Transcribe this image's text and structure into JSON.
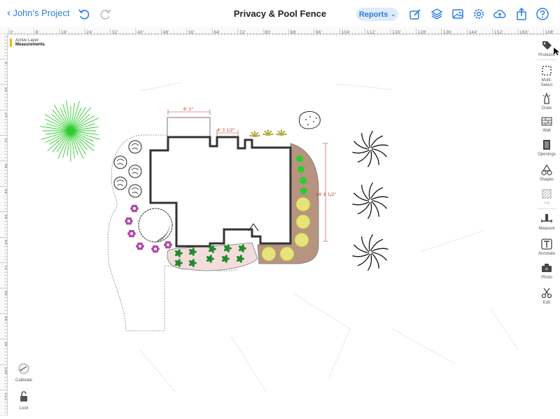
{
  "header": {
    "back_label": "John's Project",
    "title": "Privacy & Pool Fence",
    "reports_label": "Reports"
  },
  "ruler": {
    "top_ticks": [
      "0'",
      "8'",
      "16'",
      "24'",
      "32'",
      "40'",
      "48'",
      "56'",
      "64'",
      "72'",
      "80'",
      "88'",
      "96'",
      "104'",
      "112'",
      "120'",
      "128'",
      "136'",
      "144'",
      "152'",
      "160'",
      "168'"
    ],
    "left_ticks": [
      "8'",
      "16'",
      "24'",
      "32'",
      "40'",
      "48'",
      "56'",
      "64'",
      "72'",
      "80'",
      "88'",
      "96'",
      "104'",
      "112'"
    ]
  },
  "layer": {
    "caption": "Active Layer:",
    "name": "Measurements"
  },
  "dimensions": {
    "top_width": "6' 1\"",
    "top_offset": "4' 3 1/2\"",
    "bed_length": "14' 6 1/2\""
  },
  "sidebar": {
    "products": "Products",
    "multiselect_line1": "Multi-",
    "multiselect_line2": "Select",
    "draw": "Draw",
    "wall": "Wall",
    "openings": "Openings",
    "shapes": "Shapes",
    "fill": "Fill",
    "measure": "Measure",
    "annotate": "Annotate",
    "photo": "Photo",
    "edit": "Edit"
  },
  "bottom": {
    "calibrate": "Calibrate",
    "lock": "Lock"
  },
  "colors": {
    "accent": "#2a7de1",
    "bed_brown": "#b79480",
    "bed_pink": "#f2dcdc",
    "shrub_green": "#2ecc2e",
    "flower_yellow": "#e6e37a",
    "flower_purple": "#b04aa8"
  }
}
